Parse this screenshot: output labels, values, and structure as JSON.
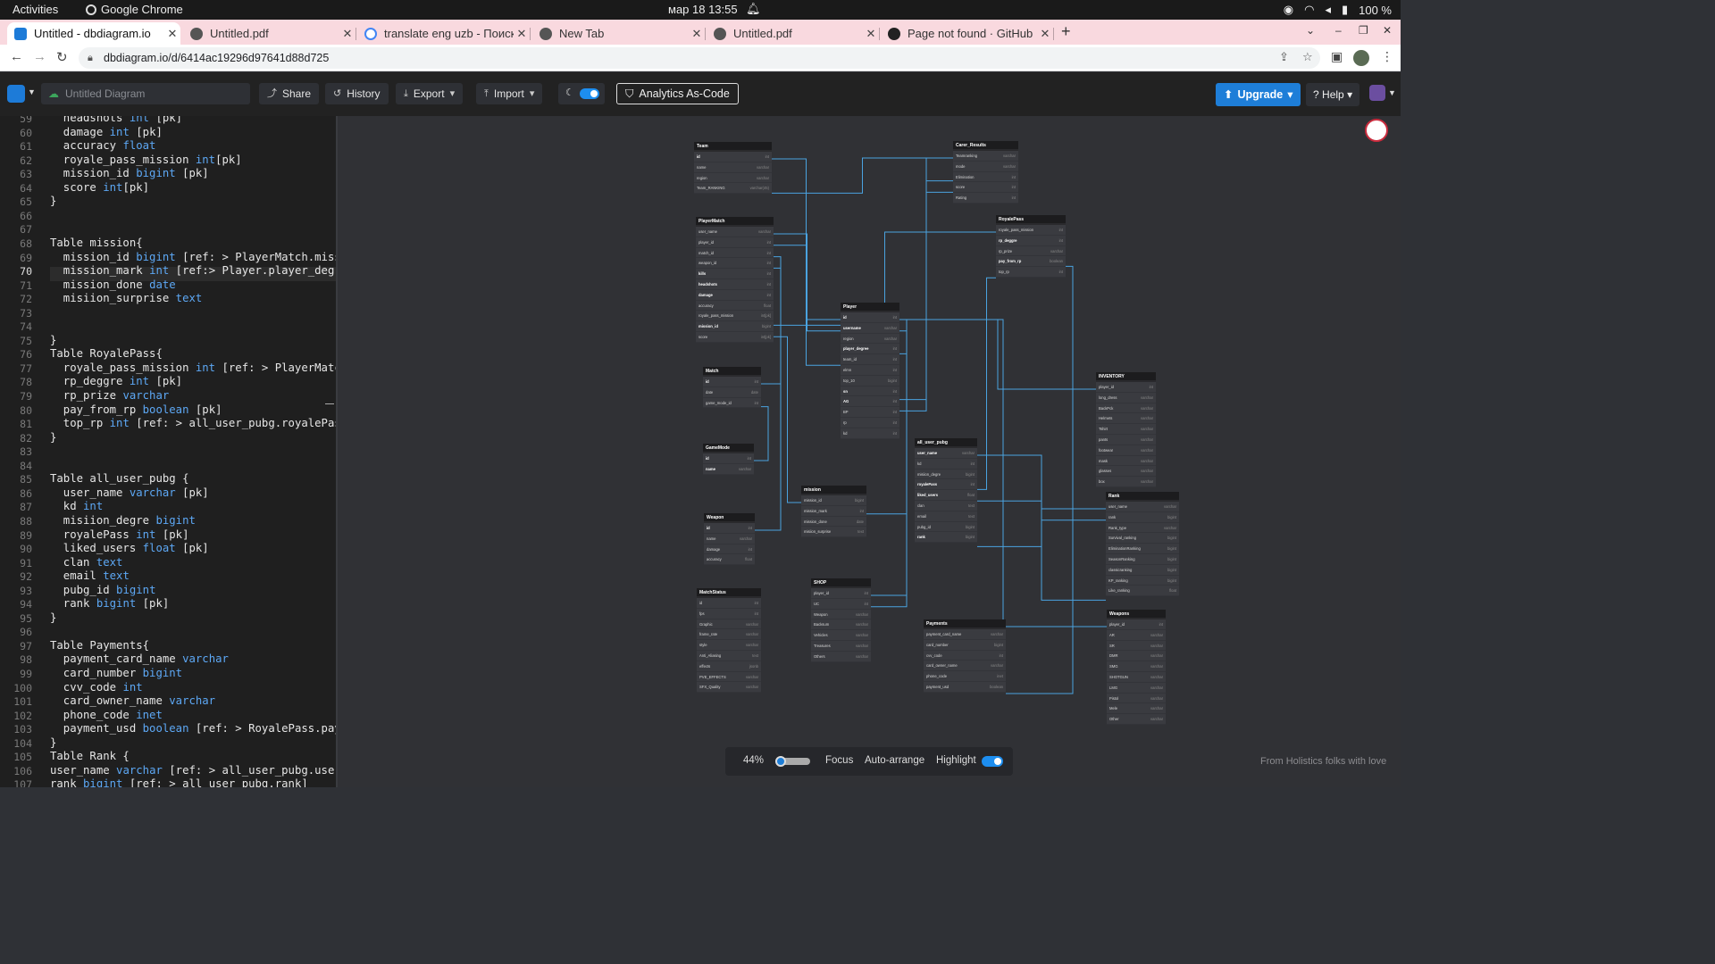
{
  "os": {
    "activities": "Activities",
    "app_name": "Google Chrome",
    "clock": "мар 18  13:55",
    "battery": "100 %"
  },
  "tabs": [
    {
      "title": "Untitled - dbdiagram.io",
      "active": true,
      "icon": "dbdiagram-icon"
    },
    {
      "title": "Untitled.pdf",
      "active": false,
      "icon": "globe-icon"
    },
    {
      "title": "translate eng uzb - Поиск",
      "active": false,
      "icon": "google-icon"
    },
    {
      "title": "New Tab",
      "active": false,
      "icon": "globe-icon"
    },
    {
      "title": "Untitled.pdf",
      "active": false,
      "icon": "globe-icon"
    },
    {
      "title": "Page not found · GitHub",
      "active": false,
      "icon": "github-icon"
    }
  ],
  "address": {
    "url": "dbdiagram.io/d/6414ac19296d97641d88d725"
  },
  "header": {
    "diagram_name_placeholder": "Untitled Diagram",
    "share": "Share",
    "history": "History",
    "export": "Export",
    "import": "Import",
    "analytics": "Analytics As-Code",
    "upgrade": "Upgrade",
    "help": "Help"
  },
  "editor": {
    "current_line": 70,
    "lines": [
      {
        "n": 59,
        "text": "  headshots int [pk]"
      },
      {
        "n": 60,
        "text": "  damage int [pk]"
      },
      {
        "n": 61,
        "text": "  accuracy float"
      },
      {
        "n": 62,
        "text": "  royale_pass_mission int[pk]"
      },
      {
        "n": 63,
        "text": "  mission_id bigint [pk]"
      },
      {
        "n": 64,
        "text": "  score int[pk]"
      },
      {
        "n": 65,
        "text": "}"
      },
      {
        "n": 66,
        "text": ""
      },
      {
        "n": 67,
        "text": ""
      },
      {
        "n": 68,
        "text": "Table mission{"
      },
      {
        "n": 69,
        "text": "  mission_id bigint [ref: > PlayerMatch.mission"
      },
      {
        "n": 70,
        "text": "  mission_mark int [ref:> Player.player_degree"
      },
      {
        "n": 71,
        "text": "  mission_done date"
      },
      {
        "n": 72,
        "text": "  misiion_surprise text"
      },
      {
        "n": 73,
        "text": ""
      },
      {
        "n": 74,
        "text": ""
      },
      {
        "n": 75,
        "text": "}"
      },
      {
        "n": 76,
        "text": "Table RoyalePass{"
      },
      {
        "n": 77,
        "text": "  royale_pass_mission int [ref: > PlayerMatch.r"
      },
      {
        "n": 78,
        "text": "  rp_deggre int [pk]"
      },
      {
        "n": 79,
        "text": "  rp_prize varchar"
      },
      {
        "n": 80,
        "text": "  pay_from_rp boolean [pk]"
      },
      {
        "n": 81,
        "text": "  top_rp int [ref: > all_user_pubg.royalePass]"
      },
      {
        "n": 82,
        "text": "}"
      },
      {
        "n": 83,
        "text": ""
      },
      {
        "n": 84,
        "text": ""
      },
      {
        "n": 85,
        "text": "Table all_user_pubg {"
      },
      {
        "n": 86,
        "text": "  user_name varchar [pk]"
      },
      {
        "n": 87,
        "text": "  kd int"
      },
      {
        "n": 88,
        "text": "  misiion_degre bigint"
      },
      {
        "n": 89,
        "text": "  royalePass int [pk]"
      },
      {
        "n": 90,
        "text": "  liked_users float [pk]"
      },
      {
        "n": 91,
        "text": "  clan text"
      },
      {
        "n": 92,
        "text": "  email text"
      },
      {
        "n": 93,
        "text": "  pubg_id bigint"
      },
      {
        "n": 94,
        "text": "  rank bigint [pk]"
      },
      {
        "n": 95,
        "text": "}"
      },
      {
        "n": 96,
        "text": ""
      },
      {
        "n": 97,
        "text": "Table Payments{"
      },
      {
        "n": 98,
        "text": "  payment_card_name varchar"
      },
      {
        "n": 99,
        "text": "  card_number bigint"
      },
      {
        "n": 100,
        "text": "  cvv_code int"
      },
      {
        "n": 101,
        "text": "  card_owner_name varchar"
      },
      {
        "n": 102,
        "text": "  phone_code inet"
      },
      {
        "n": 103,
        "text": "  payment_usd boolean [ref: > RoyalePass.pay_fr"
      },
      {
        "n": 104,
        "text": "}"
      },
      {
        "n": 105,
        "text": "Table Rank {"
      },
      {
        "n": 106,
        "text": "user_name varchar [ref: > all_user_pubg.user_na"
      },
      {
        "n": 107,
        "text": "rank bigint [ref: > all_user_pubg.rank]"
      }
    ]
  },
  "diagram": {
    "tables": [
      {
        "name": "Team",
        "rows": [
          [
            "id",
            "int",
            1
          ],
          [
            "name",
            "varchar",
            0
          ],
          [
            "region",
            "varchar",
            0
          ],
          [
            "Team_RANKING",
            "varchar(45)",
            0
          ]
        ]
      },
      {
        "name": "PlayerMatch",
        "rows": [
          [
            "user_name",
            "varchar",
            0
          ],
          [
            "player_id",
            "int",
            0
          ],
          [
            "match_id",
            "int",
            0
          ],
          [
            "weapon_id",
            "int",
            0
          ],
          [
            "kills",
            "int",
            1
          ],
          [
            "headshots",
            "int",
            1
          ],
          [
            "damage",
            "int",
            1
          ],
          [
            "accuracy",
            "float",
            0
          ],
          [
            "royale_pass_mission",
            "int[pk]",
            0
          ],
          [
            "mission_id",
            "bigint",
            1
          ],
          [
            "score",
            "int[pk]",
            0
          ]
        ]
      },
      {
        "name": "Match",
        "rows": [
          [
            "id",
            "int",
            1
          ],
          [
            "date",
            "date",
            0
          ],
          [
            "game_mode_id",
            "int",
            0
          ]
        ]
      },
      {
        "name": "GameMode",
        "rows": [
          [
            "id",
            "int",
            1
          ],
          [
            "name",
            "varchar",
            1
          ]
        ]
      },
      {
        "name": "Weapon",
        "rows": [
          [
            "id",
            "int",
            1
          ],
          [
            "name",
            "varchar",
            0
          ],
          [
            "damage",
            "int",
            0
          ],
          [
            "accuracy",
            "float",
            0
          ]
        ]
      },
      {
        "name": "MatchStatus",
        "rows": [
          [
            "id",
            "int",
            0
          ],
          [
            "fps",
            "int",
            0
          ],
          [
            "Graphic",
            "varchar",
            0
          ],
          [
            "frame_rate",
            "varchar",
            0
          ],
          [
            "style",
            "varchar",
            0
          ],
          [
            "Anti_Aliasing",
            "text",
            0
          ],
          [
            "effects",
            "jsonb",
            0
          ],
          [
            "PVE_EFFECTS",
            "varchar",
            0
          ],
          [
            "SFX_Quality",
            "varchar",
            0
          ]
        ]
      },
      {
        "name": "Carer_Results",
        "rows": [
          [
            "Teamranking",
            "varchar",
            0
          ],
          [
            "mode",
            "varchar",
            0
          ],
          [
            "Elimination",
            "int",
            0
          ],
          [
            "score",
            "int",
            0
          ],
          [
            "Rating",
            "int",
            0
          ]
        ]
      },
      {
        "name": "RoyalePass",
        "rows": [
          [
            "royale_pass_mission",
            "int",
            0
          ],
          [
            "rp_deggre",
            "int",
            1
          ],
          [
            "rp_prize",
            "varchar",
            0
          ],
          [
            "pay_from_rp",
            "boolean",
            1
          ],
          [
            "top_rp",
            "int",
            0
          ]
        ]
      },
      {
        "name": "Player",
        "rows": [
          [
            "id",
            "int",
            1
          ],
          [
            "username",
            "varchar",
            1
          ],
          [
            "region",
            "varchar",
            0
          ],
          [
            "player_degree",
            "int",
            1
          ],
          [
            "team_id",
            "int",
            0
          ],
          [
            "elmn",
            "int",
            0
          ],
          [
            "top_10",
            "bigint",
            0
          ],
          [
            "sn",
            "int",
            1
          ],
          [
            "AG",
            "int",
            1
          ],
          [
            "BP",
            "int",
            0
          ],
          [
            "rp",
            "int",
            0
          ],
          [
            "kd",
            "int",
            0
          ]
        ]
      },
      {
        "name": "all_user_pubg",
        "rows": [
          [
            "user_name",
            "varchar",
            1
          ],
          [
            "kd",
            "int",
            0
          ],
          [
            "misiion_degre",
            "bigint",
            0
          ],
          [
            "royalePass",
            "int",
            1
          ],
          [
            "liked_users",
            "float",
            1
          ],
          [
            "clan",
            "text",
            0
          ],
          [
            "email",
            "text",
            0
          ],
          [
            "pubg_id",
            "bigint",
            0
          ],
          [
            "rank",
            "bigint",
            1
          ]
        ]
      },
      {
        "name": "mission",
        "rows": [
          [
            "mission_id",
            "bigint",
            0
          ],
          [
            "mission_mark",
            "int",
            0
          ],
          [
            "mission_done",
            "date",
            0
          ],
          [
            "misiion_surprise",
            "text",
            0
          ]
        ]
      },
      {
        "name": "SHOP",
        "rows": [
          [
            "player_id",
            "int",
            0
          ],
          [
            "UC",
            "int",
            0
          ],
          [
            "Weapon",
            "varchar",
            0
          ],
          [
            "Backsum",
            "varchar",
            0
          ],
          [
            "Vehicles",
            "varchar",
            0
          ],
          [
            "Treasures",
            "varchar",
            0
          ],
          [
            "Others",
            "varchar",
            0
          ]
        ]
      },
      {
        "name": "Payments",
        "rows": [
          [
            "payment_card_name",
            "varchar",
            0
          ],
          [
            "card_number",
            "bigint",
            0
          ],
          [
            "cvv_code",
            "int",
            0
          ],
          [
            "card_owner_name",
            "varchar",
            0
          ],
          [
            "phone_code",
            "inet",
            0
          ],
          [
            "payment_usd",
            "boolean",
            0
          ]
        ]
      },
      {
        "name": "INVENTORY",
        "rows": [
          [
            "player_id",
            "int",
            0
          ],
          [
            "long_dress",
            "varchar",
            0
          ],
          [
            "BackPck",
            "varchar",
            0
          ],
          [
            "Helmets",
            "varchar",
            0
          ],
          [
            "Tshirt",
            "varchar",
            0
          ],
          [
            "pants",
            "varchar",
            0
          ],
          [
            "footwear",
            "varchar",
            0
          ],
          [
            "mask",
            "varchar",
            0
          ],
          [
            "glasses",
            "varchar",
            0
          ],
          [
            "box",
            "varchar",
            0
          ]
        ]
      },
      {
        "name": "Rank",
        "rows": [
          [
            "user_name",
            "varchar",
            0
          ],
          [
            "rank",
            "bigint",
            0
          ],
          [
            "Rank_type",
            "varchar",
            0
          ],
          [
            "Survival_ranking",
            "bigint",
            0
          ],
          [
            "EliminationRanking",
            "bigint",
            0
          ],
          [
            "SeasonRanking",
            "bigint",
            0
          ],
          [
            "classicranking",
            "bigint",
            0
          ],
          [
            "KP_ranking",
            "bigint",
            0
          ],
          [
            "Like_ranking",
            "float",
            0
          ]
        ]
      },
      {
        "name": "Weapons",
        "rows": [
          [
            "player_id",
            "int",
            0
          ],
          [
            "AR",
            "varchar",
            0
          ],
          [
            "SR",
            "varchar",
            0
          ],
          [
            "DMR",
            "varchar",
            0
          ],
          [
            "SMG",
            "varchar",
            0
          ],
          [
            "SHOTGUN",
            "varchar",
            0
          ],
          [
            "LMG",
            "varchar",
            0
          ],
          [
            "Pistol",
            "varchar",
            0
          ],
          [
            "Mele",
            "varchar",
            0
          ],
          [
            "Other",
            "varchar",
            0
          ]
        ]
      }
    ]
  },
  "bottom": {
    "zoom": "44%",
    "zoom_level": 0.44,
    "focus": "Focus",
    "auto_arrange": "Auto-arrange",
    "highlight": "Highlight",
    "credit": "From Holistics folks with love"
  },
  "colors": {
    "accent": "#1e7ed8",
    "edge": "#4aa3e0",
    "editor_type": "#5da8f5"
  }
}
